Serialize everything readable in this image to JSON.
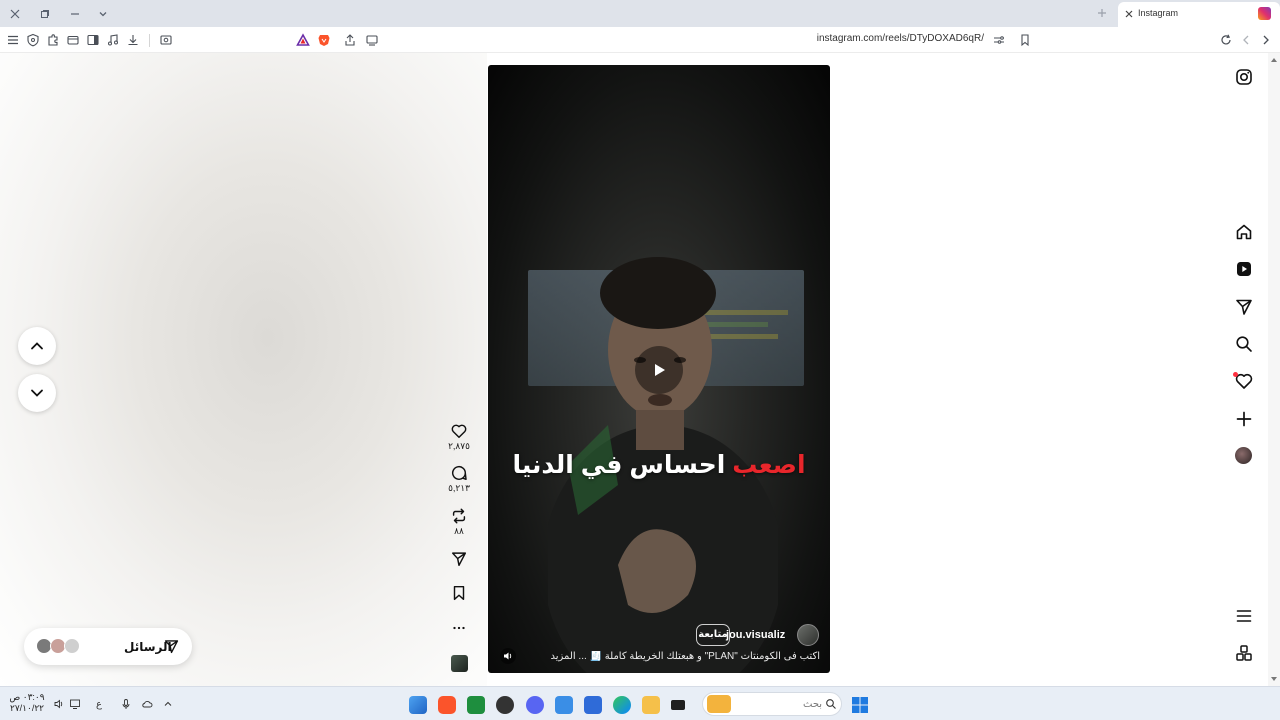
{
  "browser": {
    "tab_title": "Instagram",
    "url": "instagram.com/reels/DTyDOXAD6qR/"
  },
  "reel": {
    "subtitle_red": "اصعب",
    "subtitle_white": "احساس في الدنيا",
    "author": "jou.visualiz",
    "follow_label": "متابعة",
    "caption": "اكتب فى الكومنتات \"PLAN\" و هبعتلك الخريطة كاملة 🧾 ... المزيد"
  },
  "actions": {
    "likes": "٢,٨٧٥",
    "comments": "٥,٢١٣",
    "reposts": "٨٨"
  },
  "messages": {
    "label": "الرسائل"
  },
  "taskbar": {
    "search_placeholder": "بحث",
    "time": "٠٣:٠٩ ص",
    "date": "٢٧/١٠/٢٢",
    "lang": "ع"
  },
  "colors": {
    "accent_red": "#e8262b",
    "notification": "#ff3040"
  }
}
